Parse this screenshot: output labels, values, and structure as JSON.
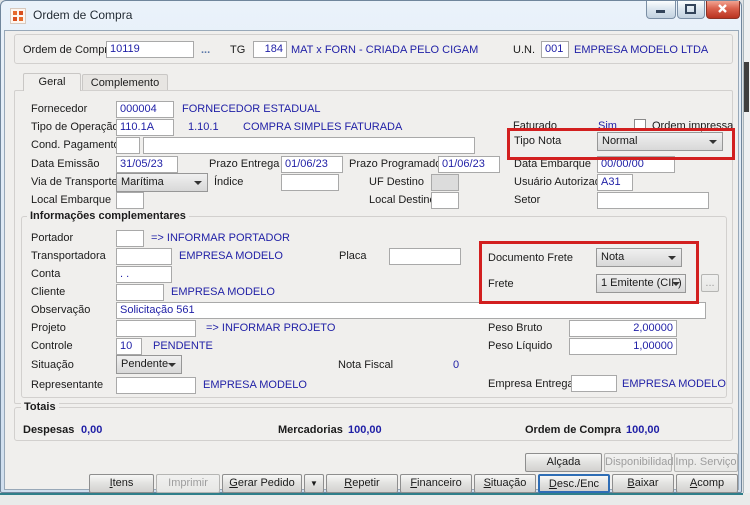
{
  "window": {
    "title": "Ordem de Compra"
  },
  "header": {
    "ordem_label": "Ordem de Compra",
    "ordem_value": "10119",
    "lookup": "...",
    "tg_label": "TG",
    "tg_value": "184",
    "tg_desc": "MAT x FORN - CRIADA PELO CIGAM",
    "un_label": "U.N.",
    "un_value": "001",
    "un_desc": "EMPRESA MODELO LTDA"
  },
  "tabs": {
    "geral": "Geral",
    "complemento": "Complemento"
  },
  "geral": {
    "fornecedor_label": "Fornecedor",
    "fornecedor_value": "000004",
    "fornecedor_desc": "FORNECEDOR ESTADUAL",
    "tipo_operacao_label": "Tipo de Operação",
    "tipo_operacao_value": "110.1A",
    "tipo_operacao_code": "1.10.1",
    "tipo_operacao_desc": "COMPRA SIMPLES FATURADA",
    "cond_pagamento_label": "Cond. Pagamento",
    "data_emissao_label": "Data Emissão",
    "data_emissao_value": "31/05/23",
    "prazo_entrega_label": "Prazo Entrega",
    "prazo_entrega_value": "01/06/23",
    "prazo_programado_label": "Prazo Programado",
    "prazo_programado_value": "01/06/23",
    "via_transporte_label": "Via de Transporte",
    "via_transporte_value": "Marítima",
    "indice_label": "Índice",
    "uf_destino_label": "UF Destino",
    "local_embarque_label": "Local Embarque",
    "local_destino_label": "Local Destino",
    "faturado_label": "Faturado",
    "faturado_value": "Sim",
    "ordem_impressa_label": "Ordem impressa",
    "tipo_nota_label": "Tipo Nota",
    "tipo_nota_value": "Normal",
    "data_embarque_label": "Data Embarque",
    "data_embarque_value": "00/00/00",
    "usuario_autorizado_label": "Usuário Autorizado",
    "usuario_autorizado_value": "A31",
    "setor_label": "Setor"
  },
  "info": {
    "legend": "Informações complementares",
    "portador_label": "Portador",
    "portador_hint": "=> INFORMAR PORTADOR",
    "transportadora_label": "Transportadora",
    "transportadora_desc": "EMPRESA MODELO",
    "placa_label": "Placa",
    "conta_label": "Conta",
    "conta_value": ". .",
    "cliente_label": "Cliente",
    "cliente_desc": "EMPRESA MODELO",
    "observacao_label": "Observação",
    "observacao_value": "Solicitação 561",
    "projeto_label": "Projeto",
    "projeto_hint": "=> INFORMAR PROJETO",
    "controle_label": "Controle",
    "controle_value": "10",
    "controle_desc": "PENDENTE",
    "situacao_label": "Situação",
    "situacao_value": "Pendente",
    "nota_fiscal_label": "Nota Fiscal",
    "nota_fiscal_value": "0",
    "representante_label": "Representante",
    "representante_desc": "EMPRESA MODELO",
    "documento_frete_label": "Documento Frete",
    "documento_frete_value": "Nota",
    "frete_label": "Frete",
    "frete_value": "1 Emitente (CIF)",
    "frete_lookup": "...",
    "peso_bruto_label": "Peso Bruto",
    "peso_bruto_value": "2,00000",
    "peso_liquido_label": "Peso Líquido",
    "peso_liquido_value": "1,00000",
    "empresa_entrega_label": "Empresa Entrega",
    "empresa_entrega_desc": "EMPRESA MODELO"
  },
  "totais": {
    "legend": "Totais",
    "despesas_label": "Despesas",
    "despesas_value": "0,00",
    "mercadorias_label": "Mercadorias",
    "mercadorias_value": "100,00",
    "ordem_compra_label": "Ordem de Compra",
    "ordem_compra_value": "100,00"
  },
  "buttons": {
    "alcada": "Alçada",
    "disponibilidade": "Disponibilidade",
    "imp_servico": "Imp. Serviço",
    "itens": "Itens",
    "imprimir": "Imprimir",
    "gerar_pedido": "Gerar Pedido",
    "arrow": "▼",
    "repetir": "Repetir",
    "financeiro": "Financeiro",
    "situacao": "Situação",
    "desc_enc": "Desc./Enc",
    "baixar": "Baixar",
    "acomp": "Acomp"
  },
  "colors": {
    "annotation_red": "#d21f1f",
    "value_navy": "#1f1fa6",
    "focus_blue": "#2e6db5"
  }
}
